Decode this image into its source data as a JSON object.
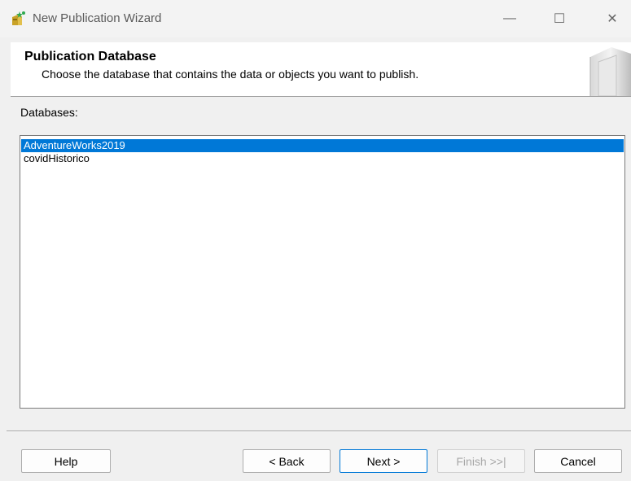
{
  "window": {
    "title": "New Publication Wizard",
    "icon": "publication-wizard-icon"
  },
  "window_controls": {
    "minimize": "—",
    "maximize": "☐",
    "close": "✕"
  },
  "header": {
    "title": "Publication Database",
    "subtitle": "Choose the database that contains the data or objects you want to publish."
  },
  "databases": {
    "label": "Databases:",
    "items": [
      "AdventureWorks2019",
      "covidHistorico"
    ],
    "selected": "AdventureWorks2019"
  },
  "buttons": {
    "help": "Help",
    "back": "< Back",
    "next": "Next >",
    "finish": "Finish >>|",
    "cancel": "Cancel"
  },
  "colors": {
    "selection": "#0078d7",
    "default_button_border": "#0078d7"
  }
}
